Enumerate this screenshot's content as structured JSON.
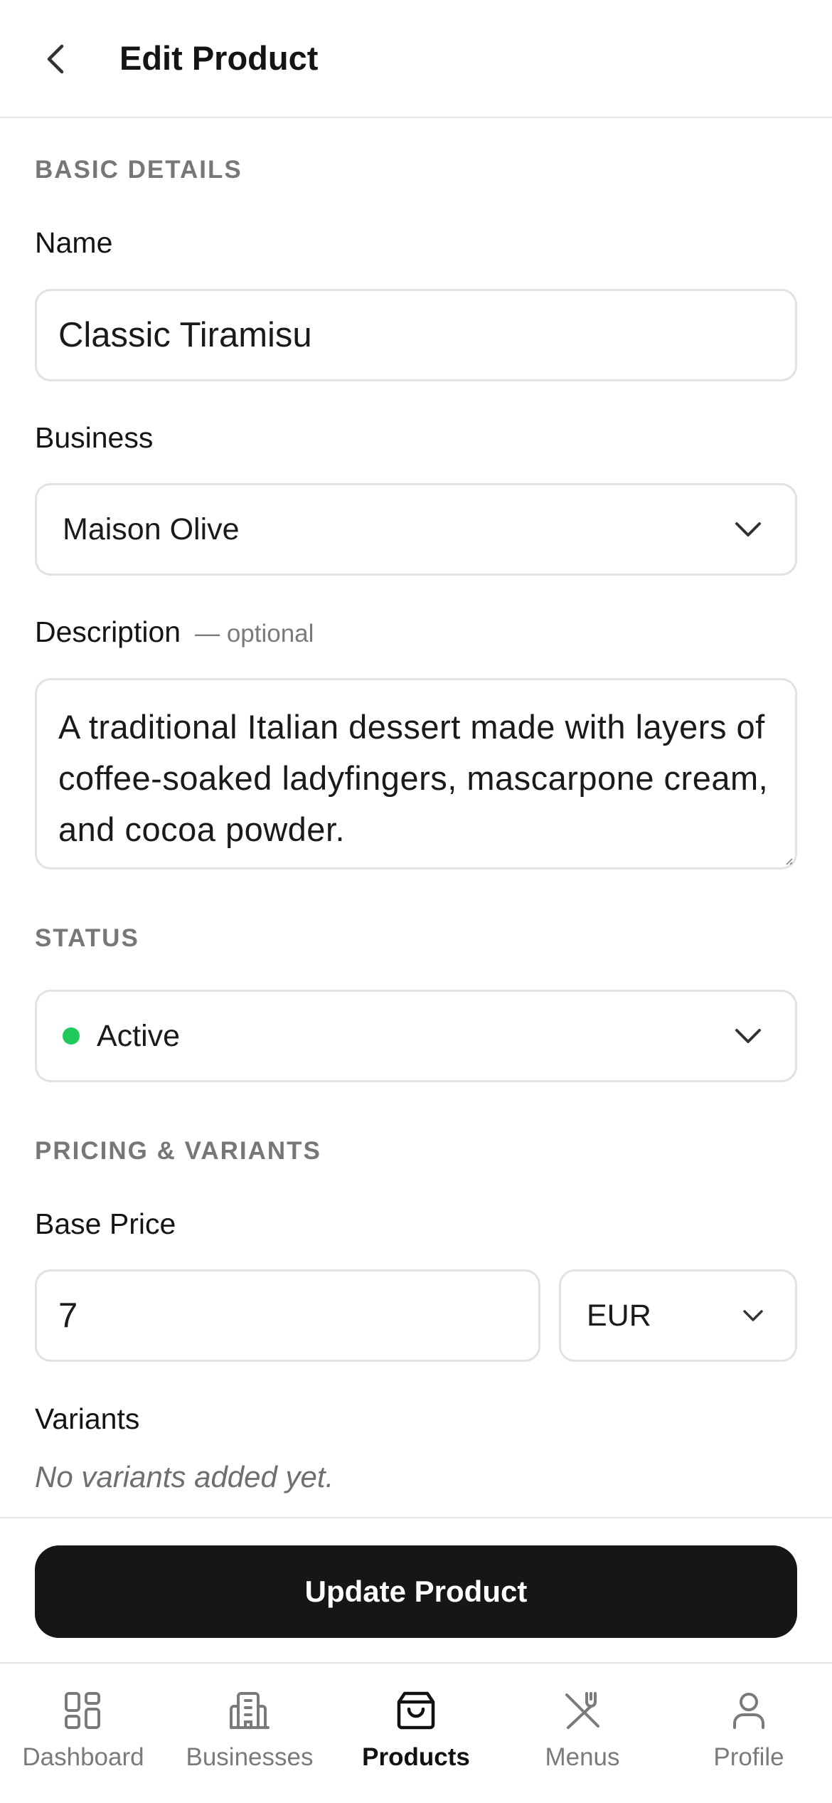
{
  "header": {
    "title": "Edit Product",
    "back_icon": "chevron-left-icon"
  },
  "basic_details": {
    "section_title": "BASIC DETAILS",
    "name_label": "Name",
    "name_value": "Classic Tiramisu",
    "business_label": "Business",
    "business_value": "Maison Olive",
    "description_label": "Description",
    "description_optional": "— optional",
    "description_value": "A traditional Italian dessert made with layers of coffee-soaked ladyfingers, mascarpone cream, and cocoa powder."
  },
  "status": {
    "section_title": "STATUS",
    "value": "Active",
    "indicator_color": "#1ec95a"
  },
  "pricing": {
    "section_title": "PRICING & VARIANTS",
    "base_price_label": "Base Price",
    "base_price_value": "7",
    "currency_value": "EUR",
    "variants_label": "Variants",
    "variants_empty": "No variants added yet."
  },
  "actions": {
    "update_label": "Update Product"
  },
  "tabbar": {
    "items": [
      {
        "label": "Dashboard",
        "icon": "grid-icon",
        "active": false
      },
      {
        "label": "Businesses",
        "icon": "building-icon",
        "active": false
      },
      {
        "label": "Products",
        "icon": "shopping-bag-icon",
        "active": true
      },
      {
        "label": "Menus",
        "icon": "utensils-icon",
        "active": false
      },
      {
        "label": "Profile",
        "icon": "user-icon",
        "active": false
      }
    ]
  }
}
